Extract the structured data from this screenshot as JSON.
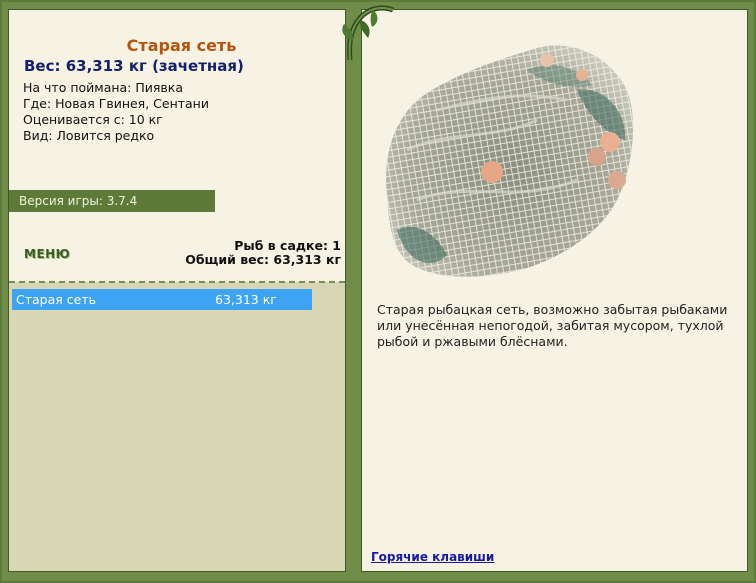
{
  "fish": {
    "name": "Старая сеть",
    "weight_line": "Вес: 63,313 кг (зачетная)",
    "bait_line": "На что поймана: Пиявка",
    "location_line": "Где: Новая Гвинея, Сентани",
    "value_line": "Оценивается с: 10 кг",
    "kind_line": "Вид: Ловится редко",
    "description": "Старая рыбацкая сеть, возможно забытая рыбаками или унесённая непогодой, забитая мусором, тухлой рыбой и ржавыми блёснами."
  },
  "version_label": "Версия игры: 3.7.4",
  "menu_label": "МЕНЮ",
  "keep_net": {
    "count_line": "Рыб в садке: 1",
    "total_line": "Общий вес: 63,313 кг"
  },
  "list": [
    {
      "name": "Старая сеть",
      "weight": "63,313 кг"
    }
  ],
  "hotkeys_label": "Горячие клавиши",
  "colors": {
    "frame": "#5c7a3a",
    "panel": "#f6f3e4",
    "title": "#b5540e",
    "weight": "#15216b",
    "selection": "#3da3f5"
  }
}
